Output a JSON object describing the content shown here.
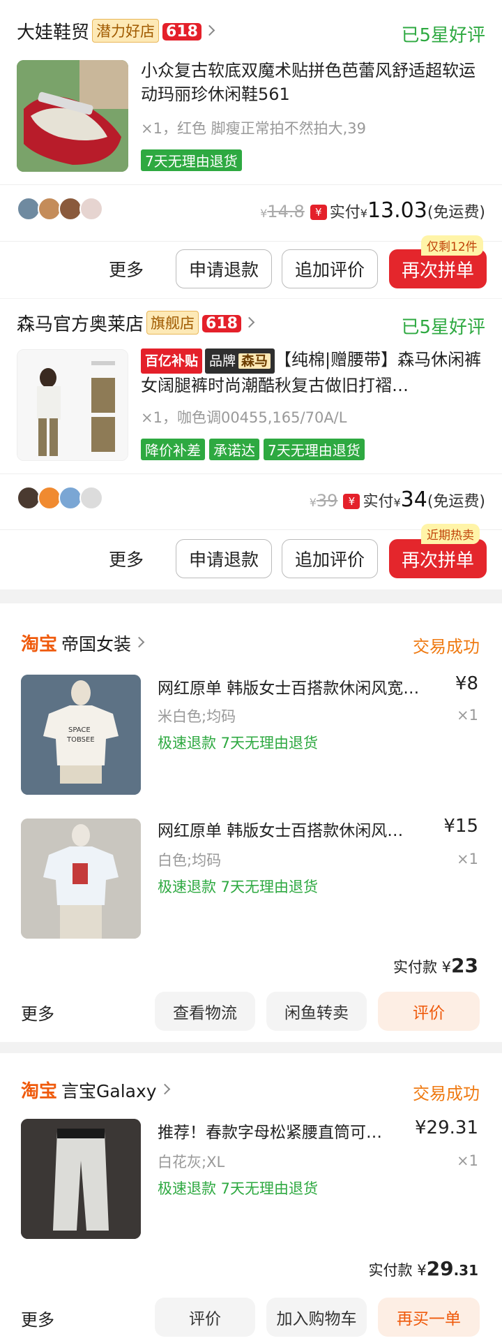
{
  "order1": {
    "shop_name": "大娃鞋贸",
    "shop_badge": "潜力好店",
    "promo_badge": "618",
    "status": "已5星好评",
    "product_title": "小众复古软底双魔术贴拼色芭蕾风舒适超软运动玛丽珍休闲鞋561",
    "product_spec": "×1，红色 脚瘦正常拍不然拍大,39",
    "tags": [
      "7天无理由退货"
    ],
    "original_price": "14.8",
    "paid_label": "实付",
    "paid_currency": "¥",
    "paid_amount": "13.03",
    "shipping": "(免运费)",
    "paid_icon": "¥",
    "buttons": {
      "more": "更多",
      "refund": "申请退款",
      "append_review": "追加评价",
      "rebuy": "再次拼单"
    },
    "corner_tip": "仅剩12件"
  },
  "order2": {
    "shop_name": "森马官方奥莱店",
    "shop_badge": "旗舰店",
    "promo_badge": "618",
    "status": "已5星好评",
    "title_tag_subsidy": "百亿补贴",
    "title_tag_brand": "品牌",
    "title_tag_brand_name": "森马",
    "product_title": "【纯棉|赠腰带】森马休闲裤女阔腿裤时尚潮酷秋复古做旧打褶…",
    "product_spec": "×1，咖色调00455,165/70A/L",
    "tags": [
      "降价补差",
      "承诺达",
      "7天无理由退货"
    ],
    "original_price": "39",
    "paid_label": "实付",
    "paid_currency": "¥",
    "paid_amount": "34",
    "shipping": "(免运费)",
    "paid_icon": "¥",
    "buttons": {
      "more": "更多",
      "refund": "申请退款",
      "append_review": "追加评价",
      "rebuy": "再次拼单"
    },
    "corner_tip": "近期热卖"
  },
  "order3": {
    "platform": "淘宝",
    "shop_name": "帝国女装",
    "status": "交易成功",
    "items": [
      {
        "title": "网红原单 韩版女士百搭款休闲风宽…",
        "price": "¥8",
        "spec": "米白色;均码",
        "qty": "×1",
        "tags": "极速退款  7天无理由退货"
      },
      {
        "title": "网红原单 韩版女士百搭款休闲风…",
        "price": "¥15",
        "spec": "白色;均码",
        "qty": "×1",
        "tags": "极速退款  7天无理由退货"
      }
    ],
    "paid_label": "实付款",
    "paid_currency": "¥",
    "paid_amount": "23",
    "buttons": {
      "more": "更多",
      "logistics": "查看物流",
      "resell": "闲鱼转卖",
      "review": "评价"
    }
  },
  "order4": {
    "platform": "淘宝",
    "shop_name": "言宝Galaxy",
    "status": "交易成功",
    "items": [
      {
        "title": "推荐！春款字母松紧腰直筒可…",
        "price": "¥29.31",
        "spec": "白花灰;XL",
        "qty": "×1",
        "tags": "极速退款  7天无理由退货"
      }
    ],
    "paid_label": "实付款",
    "paid_currency": "¥",
    "paid_amount_int": "29",
    "paid_amount_dec": ".31",
    "buttons": {
      "more": "更多",
      "review": "评价",
      "add_cart": "加入购物车",
      "rebuy": "再买一单"
    }
  },
  "colors": {
    "brand_red": "#e4262c",
    "success_green": "#2ea941",
    "taobao_orange": "#ef5a0c"
  }
}
